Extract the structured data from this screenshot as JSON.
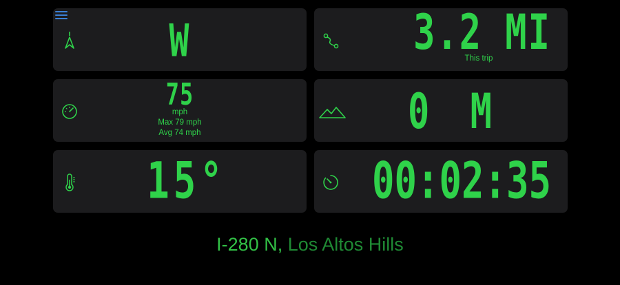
{
  "colors": {
    "lcd_green": "#2fd24a",
    "tile_bg": "#1c1c1e",
    "background": "#000000",
    "menu_accent": "#3a7fd5",
    "location_road": "#32c146",
    "location_place": "#1f8a34"
  },
  "icons": {
    "menu": "hamburger-menu-icon",
    "heading": "navigation-arrow-icon",
    "trip": "route-icon",
    "speed": "speedometer-icon",
    "altitude": "mountains-icon",
    "temperature": "thermometer-icon",
    "timer": "stopwatch-icon"
  },
  "heading": {
    "value": "W"
  },
  "trip": {
    "value": "3.2 MI",
    "label": "This trip"
  },
  "speed": {
    "value": "75",
    "unit": "mph",
    "max": "Max 79 mph",
    "avg": "Avg 74 mph"
  },
  "altitude": {
    "value": "0 M"
  },
  "temperature": {
    "value": "15°"
  },
  "timer": {
    "value": "00:02:35"
  },
  "location": {
    "road": "I-280 N",
    "separator": ", ",
    "place": "Los Altos Hills"
  }
}
